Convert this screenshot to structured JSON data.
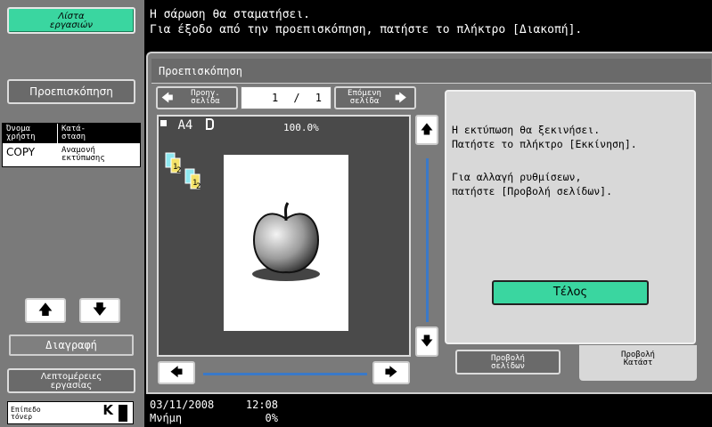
{
  "message": {
    "line1": "Η σάρωση θα σταματήσει.",
    "line2": "Για έξοδο από την προεπισκόπηση, πατήστε το πλήκτρο [Διακοπή]."
  },
  "left": {
    "job_list_label": "Λίστα εργασιών",
    "preview_label": "Προεπισκόπηση",
    "table_headers": [
      "Όνομα χρήστη",
      "Κατά-σταση"
    ],
    "table_rows": [
      [
        "COPY",
        "Αναμονή εκτύπωσης"
      ]
    ],
    "delete_label": "Διαγραφή",
    "details_label": "Λεπτομέρειες εργασίας",
    "toner_label": "Επίπεδο τόνερ",
    "toner_color": "K"
  },
  "dialog": {
    "title": "Προεπισκόπηση",
    "prev_label": "Προηγ. σελίδα",
    "next_label": "Επόμενη σελίδα",
    "page_current": "1",
    "page_sep": "/",
    "page_total": "1",
    "paper_size": "A4",
    "zoom": "100.0%",
    "message1_line1": "Η εκτύπωση θα ξεκινήσει.",
    "message1_line2": "Πατήστε το πλήκτρο [Εκκίνηση].",
    "message2_line1": "Για αλλαγή ρυθμίσεων,",
    "message2_line2": "πατήστε [Προβολή σελίδων].",
    "end_label": "Τέλος",
    "tab_pages": "Προβολή σελίδων",
    "tab_status": "Προβολή Κατάστ"
  },
  "status": {
    "date": "03/11/2008",
    "time": "12:08",
    "memory_label": "Μνήμη",
    "memory_value": "0%"
  },
  "colors": {
    "accent_green": "#3ad6a0",
    "panel_gray": "#7a7a7a",
    "scroll_blue": "#3a79c8"
  }
}
